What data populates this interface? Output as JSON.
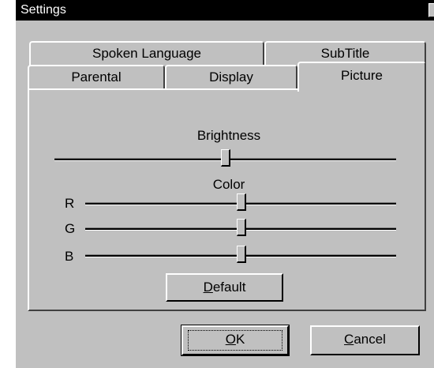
{
  "window": {
    "title": "Settings",
    "close_glyph": "×"
  },
  "tabs": {
    "row_back": [
      "Spoken Language",
      "SubTitle"
    ],
    "row_front": [
      "Parental",
      "Display",
      "Picture"
    ],
    "selected": "Picture"
  },
  "picture": {
    "brightness": {
      "label": "Brightness",
      "value_fraction": 0.51
    },
    "color": {
      "label": "Color",
      "channels": [
        {
          "label": "R",
          "value_fraction": 0.51
        },
        {
          "label": "G",
          "value_fraction": 0.51
        },
        {
          "label": "B",
          "value_fraction": 0.51
        }
      ]
    },
    "default_button": {
      "mnemonic": "D",
      "rest": "efault"
    }
  },
  "buttons": {
    "ok": {
      "mnemonic": "O",
      "rest": "K"
    },
    "cancel": {
      "mnemonic": "C",
      "rest": "ancel"
    }
  }
}
